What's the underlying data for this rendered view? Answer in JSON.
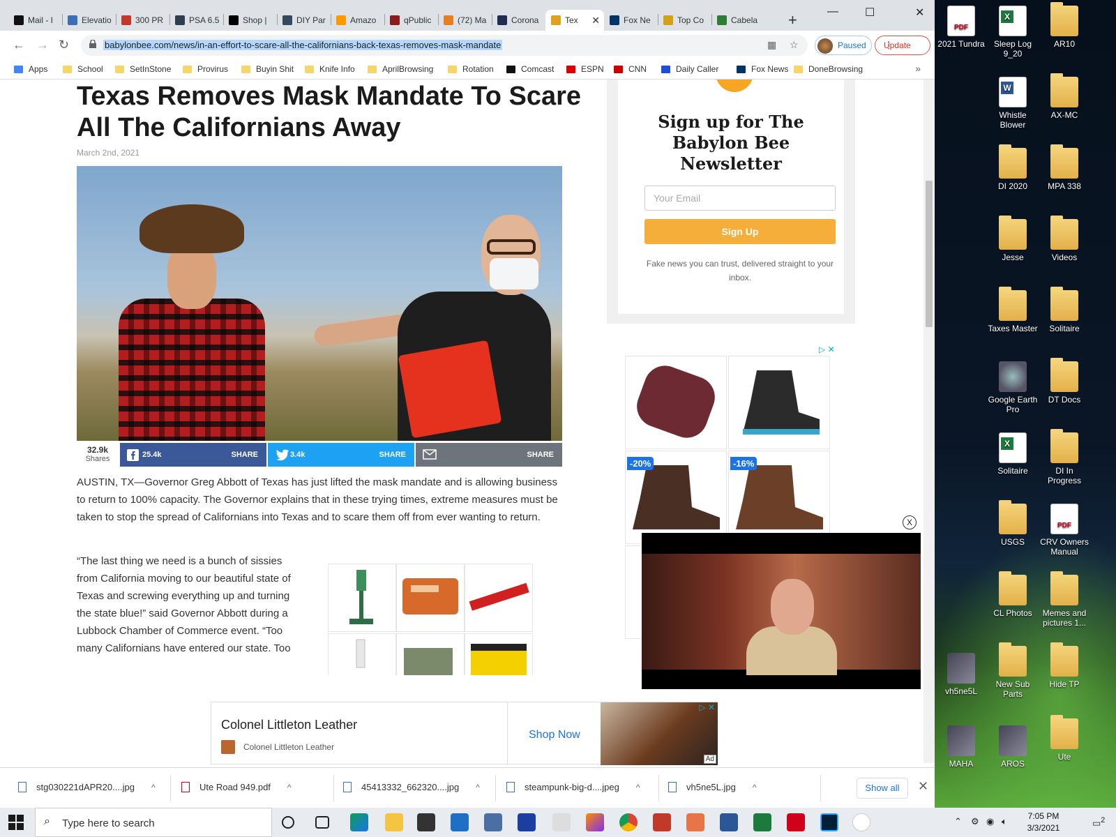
{
  "tabs": [
    {
      "title": "Mail - I",
      "color": "#111111"
    },
    {
      "title": "Elevatio",
      "color": "#3b6fb6"
    },
    {
      "title": "300 PR",
      "color": "#c0392b"
    },
    {
      "title": "PSA 6.5",
      "color": "#2c3e50"
    },
    {
      "title": "Shop |",
      "color": "#000000"
    },
    {
      "title": "DIY Par",
      "color": "#34495e"
    },
    {
      "title": "Amazo",
      "color": "#ff9900"
    },
    {
      "title": "qPublic",
      "color": "#8e1b1b"
    },
    {
      "title": "(72) Ma",
      "color": "#e67e22"
    },
    {
      "title": "Corona",
      "color": "#1f2d55"
    },
    {
      "title": "Tex",
      "color": "#e0a020",
      "active": true
    },
    {
      "title": "Fox Ne",
      "color": "#003366"
    },
    {
      "title": "Top Co",
      "color": "#d4a017"
    },
    {
      "title": "Cabela",
      "color": "#2e7d32"
    }
  ],
  "address": {
    "url": "babylonbee.com/news/in-an-effort-to-scare-all-the-californians-back-texas-removes-mask-mandate"
  },
  "profile": {
    "label": "Paused"
  },
  "update": {
    "label": "Update"
  },
  "bookmarks": [
    {
      "label": "Apps",
      "kind": "apps"
    },
    {
      "label": "School"
    },
    {
      "label": "SetInStone"
    },
    {
      "label": "Provirus"
    },
    {
      "label": "Buyin Shit"
    },
    {
      "label": "Knife Info"
    },
    {
      "label": "AprilBrowsing"
    },
    {
      "label": "Rotation"
    },
    {
      "label": "Comcast",
      "kind": "x"
    },
    {
      "label": "ESPN",
      "kind": "espn"
    },
    {
      "label": "CNN",
      "kind": "cnn"
    },
    {
      "label": "Daily Caller",
      "kind": "dc"
    },
    {
      "label": "Fox News",
      "kind": "fox"
    },
    {
      "label": "DoneBrowsing"
    }
  ],
  "article": {
    "title": "Texas Removes Mask Mandate To Scare All The Californians Away",
    "date": "March 2nd, 2021",
    "p1": "AUSTIN, TX—Governor Greg Abbott of Texas has just lifted the mask mandate and is allowing business to return to 100% capacity. The Governor explains that in these trying times, extreme measures must be taken to stop the spread of Californians into Texas and to scare them off from ever wanting to return.",
    "p2": "“The last thing we need is a bunch of sissies from California moving to our beautiful state of Texas and screwing everything up and turning the state blue!” said Governor Abbott during a Lubbock Chamber of Commerce event. “Too many Californians have entered our state. Too"
  },
  "share": {
    "total": "32.9k",
    "total_label": "Shares",
    "facebook_count": "25.4k",
    "twitter_count": "3.4k",
    "share_label": "SHARE"
  },
  "newsletter": {
    "title": "Sign up for The Babylon Bee Newsletter",
    "email_placeholder": "Your Email",
    "button": "Sign Up",
    "tagline": "Fake news you can trust, delivered straight to your inbox."
  },
  "side_ads": {
    "discount1": "-20%",
    "discount2": "-16%"
  },
  "bottom_ad": {
    "advertiser": "Colonel Littleton Leather",
    "sub": "Colonel Littleton Leather",
    "cta": "Shop Now",
    "ad_label": "Ad"
  },
  "downloads": [
    {
      "name": "stg030221dAPR20....jpg",
      "type": "img"
    },
    {
      "name": "Ute Road 949.pdf",
      "type": "pdf"
    },
    {
      "name": "45413332_662320....jpg",
      "type": "img"
    },
    {
      "name": "steampunk-big-d....jpeg",
      "type": "img"
    },
    {
      "name": "vh5ne5L.jpg",
      "type": "img"
    }
  ],
  "downloads_show_all": "Show all",
  "desktop_icons": [
    {
      "label": "2021 Tundra",
      "type": "pdf"
    },
    {
      "label": "Sleep Log 9_20",
      "type": "xls"
    },
    {
      "label": "AR10",
      "type": "folder"
    },
    {
      "label": "Whistle Blower",
      "type": "doc"
    },
    {
      "label": "AX-MC",
      "type": "folder"
    },
    {
      "label": "DI 2020",
      "type": "folder"
    },
    {
      "label": "MPA 338",
      "type": "folder"
    },
    {
      "label": "Jesse",
      "type": "folder"
    },
    {
      "label": "Videos",
      "type": "folder"
    },
    {
      "label": "Taxes Master",
      "type": "folder"
    },
    {
      "label": "Solitaire",
      "type": "folder"
    },
    {
      "label": "Google Earth Pro",
      "type": "earth"
    },
    {
      "label": "DT Docs",
      "type": "folder"
    },
    {
      "label": "Solitaire",
      "type": "xls"
    },
    {
      "label": "DI In Progress",
      "type": "folder"
    },
    {
      "label": "USGS",
      "type": "folder"
    },
    {
      "label": "CRV Owners Manual",
      "type": "pdf"
    },
    {
      "label": "CL Photos",
      "type": "folder"
    },
    {
      "label": "Memes and pictures 1...",
      "type": "folder"
    },
    {
      "label": "vh5ne5L",
      "type": "img"
    },
    {
      "label": "New Sub Parts",
      "type": "folder"
    },
    {
      "label": "Hide TP",
      "type": "folder"
    },
    {
      "label": "MAHA",
      "type": "img"
    },
    {
      "label": "AROS",
      "type": "img"
    },
    {
      "label": "Ute",
      "type": "folder"
    }
  ],
  "taskbar": {
    "search_placeholder": "Type here to search",
    "time": "7:05 PM",
    "date": "3/3/2021",
    "notifications": "2"
  }
}
